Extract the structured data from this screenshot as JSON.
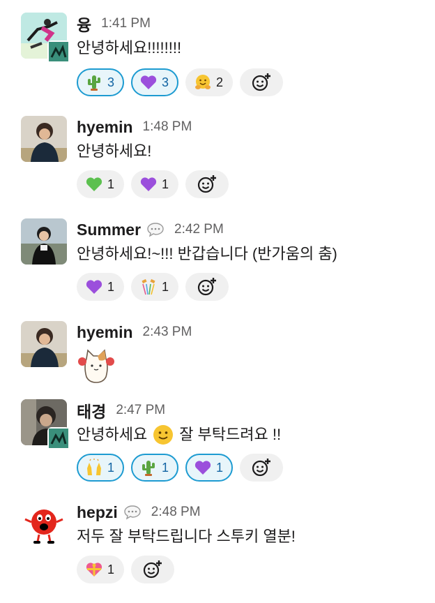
{
  "messages": [
    {
      "author": "융",
      "time": "1:41 PM",
      "text": "안녕하세요!!!!!!!!",
      "reactions": [
        {
          "emoji": "cactus-emoji",
          "count": "3",
          "mine": true
        },
        {
          "emoji": "purple-heart-emoji",
          "count": "3",
          "mine": true
        },
        {
          "emoji": "hugging-face-emoji",
          "count": "2",
          "mine": false
        }
      ]
    },
    {
      "author": "hyemin",
      "time": "1:48 PM",
      "text": "안녕하세요!",
      "reactions": [
        {
          "emoji": "green-heart-emoji",
          "count": "1",
          "mine": false
        },
        {
          "emoji": "purple-heart-emoji",
          "count": "1",
          "mine": false
        }
      ]
    },
    {
      "author": "Summer",
      "time": "2:42 PM",
      "text": "안녕하세요!~!!! 반갑습니다 (반가움의 춤)",
      "reactions": [
        {
          "emoji": "purple-heart-emoji",
          "count": "1",
          "mine": false
        },
        {
          "emoji": "confetti-emoji",
          "count": "1",
          "mine": false
        }
      ]
    },
    {
      "author": "hyemin",
      "time": "2:43 PM",
      "text": "",
      "reactions": []
    },
    {
      "author": "태경",
      "time": "2:47 PM",
      "text_before": "안녕하세요",
      "text_after": "잘 부탁드려요 !!",
      "reactions": [
        {
          "emoji": "raising-hands-emoji",
          "count": "1",
          "mine": true
        },
        {
          "emoji": "cactus-emoji",
          "count": "1",
          "mine": true
        },
        {
          "emoji": "purple-heart-emoji",
          "count": "1",
          "mine": true
        }
      ]
    },
    {
      "author": "hepzi",
      "time": "2:48 PM",
      "text": "저두 잘 부탁드립니다 스투키 열분!",
      "reactions": [
        {
          "emoji": "heart-with-ribbon-emoji",
          "count": "1",
          "mine": false
        }
      ]
    }
  ],
  "colors": {
    "reaction_mine_border": "#1d9bd1",
    "reaction_mine_bg": "#e8f5fa",
    "reaction_bg": "#f0f0f0",
    "timestamp": "#616061"
  }
}
